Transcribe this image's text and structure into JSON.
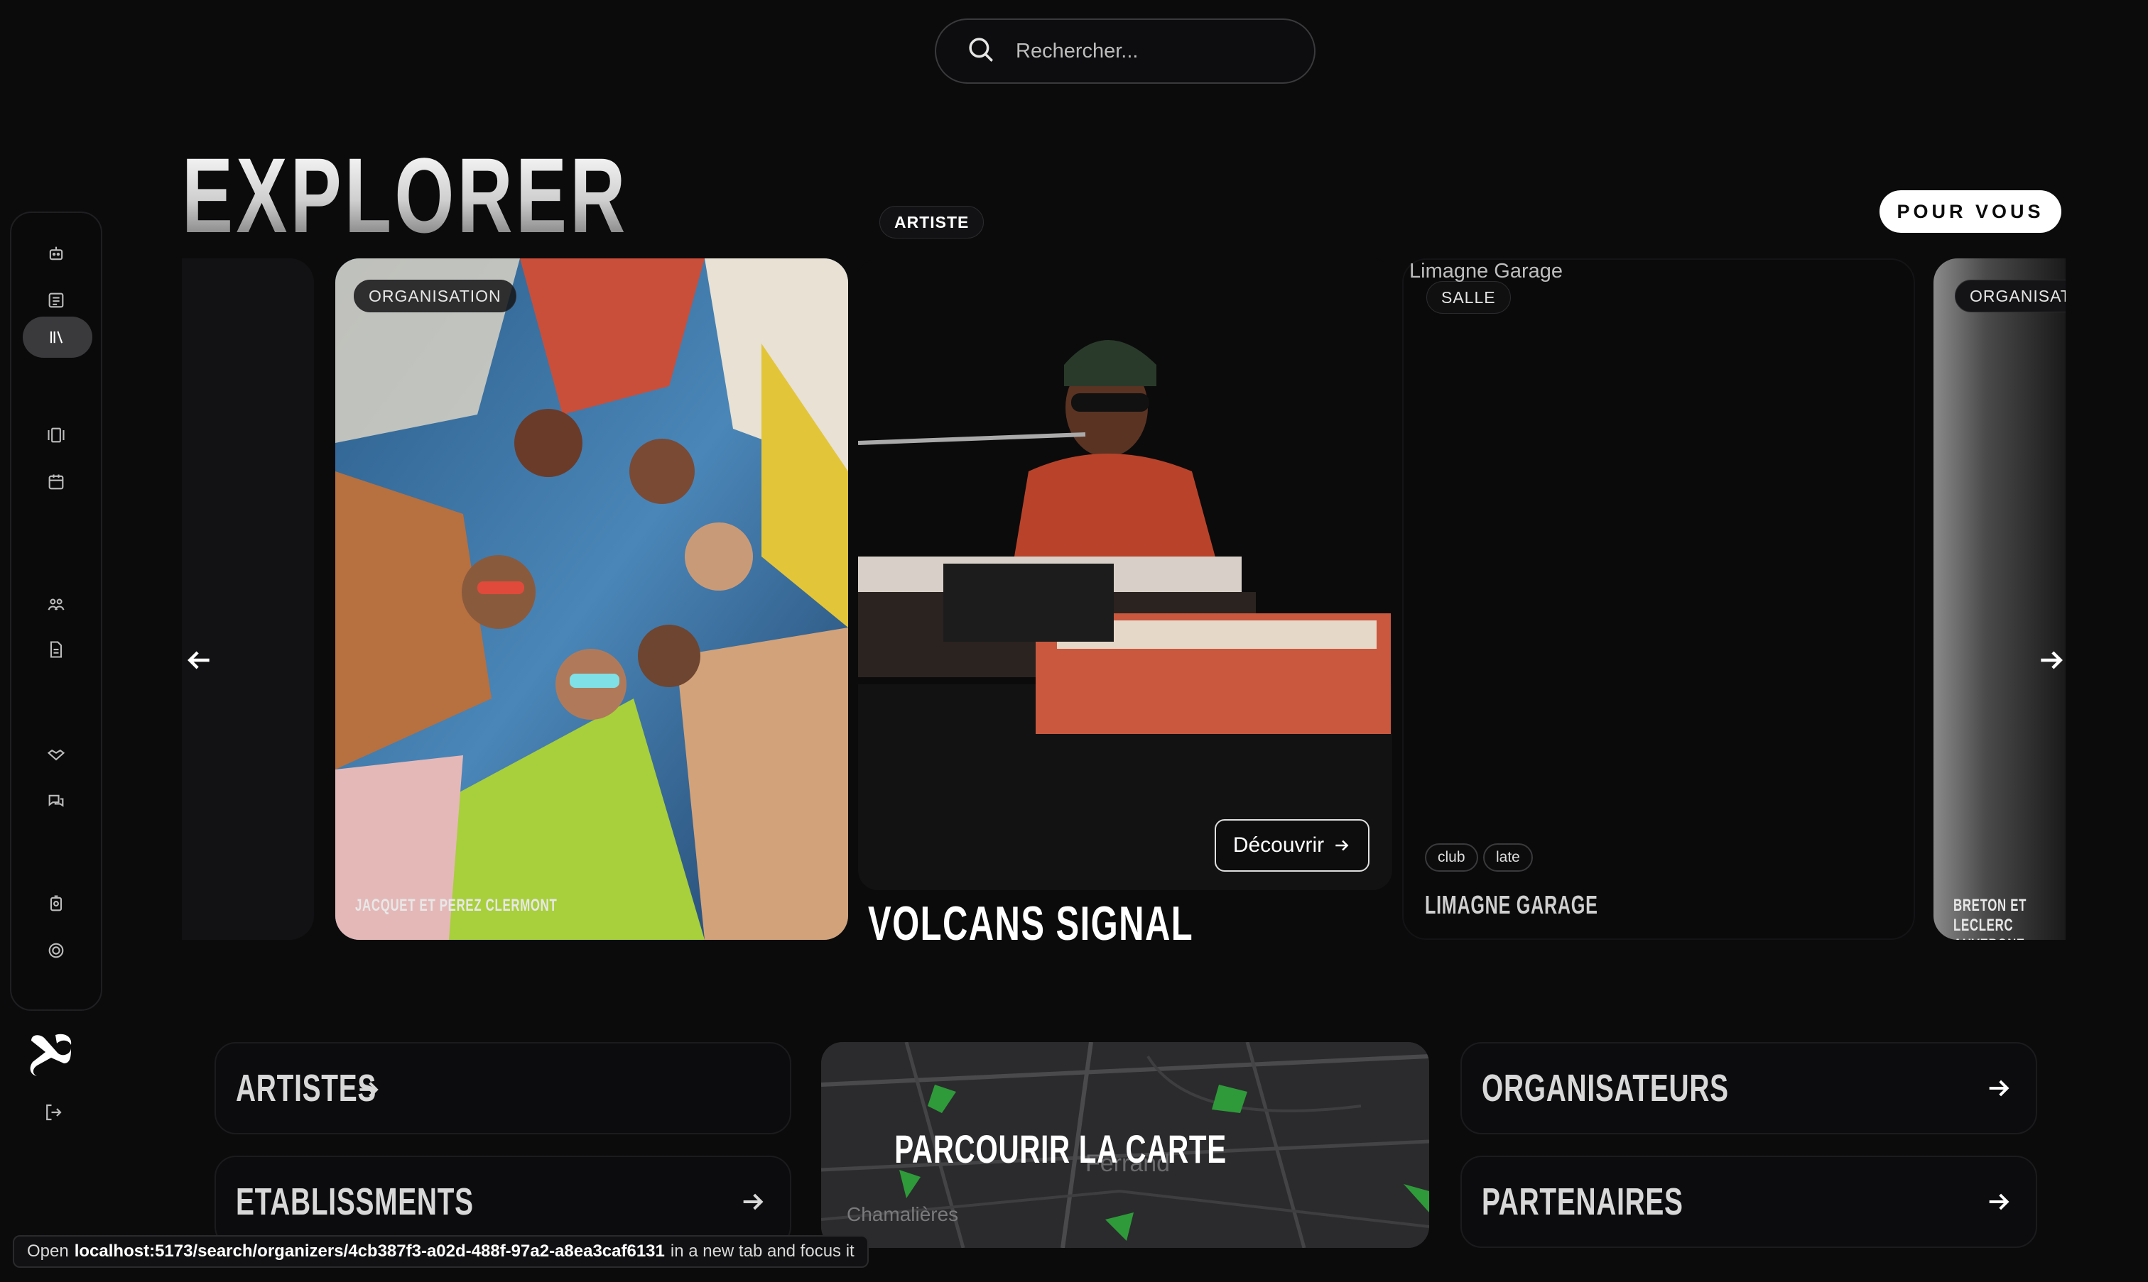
{
  "search": {
    "placeholder": "Rechercher..."
  },
  "sidebar": {
    "items": [
      {
        "icon": "robot-icon"
      },
      {
        "icon": "newspaper-icon"
      },
      {
        "icon": "library-icon",
        "active": true
      },
      {
        "icon": "gallery-icon"
      },
      {
        "icon": "calendar-icon"
      },
      {
        "icon": "crowd-icon"
      },
      {
        "icon": "document-icon"
      },
      {
        "icon": "handshake-icon"
      },
      {
        "icon": "chat-icon"
      },
      {
        "icon": "badge-icon"
      },
      {
        "icon": "coin-icon"
      }
    ],
    "logo": "brand-logo",
    "logout": "logout-icon"
  },
  "page": {
    "title": "EXPLORER",
    "filter_button": "POUR VOUS"
  },
  "carousel": {
    "cards": [
      {
        "type": "ORGANISATION",
        "caption": "JACQUET ET PEREZ CLERMONT"
      },
      {
        "type": "ARTISTE",
        "name": "VOLCANS SIGNAL",
        "cta": "Découvrir"
      },
      {
        "type": "SALLE",
        "image_alt": "Limagne Garage",
        "tags": [
          "club",
          "late"
        ],
        "caption": "LIMAGNE GARAGE"
      },
      {
        "type": "ORGANISATION",
        "caption": "BRETON ET LECLERC AUVERGNE"
      }
    ]
  },
  "tiles": {
    "artistes": "ARTISTES",
    "etablissements": "ETABLISSMENTS",
    "map": "PARCOURIR LA CARTE",
    "map_places": [
      "Chamalières",
      "Ferrand"
    ],
    "organisateurs": "ORGANISATEURS",
    "partenaires": "PARTENAIRES"
  },
  "status": {
    "prefix": "Open",
    "url": "localhost:5173/search/organizers/4cb387f3-a02d-488f-97a2-a8ea3caf6131",
    "suffix": "in a new tab and focus it"
  },
  "colors": {
    "background": "#0b0b0c",
    "accent": "#ffffff",
    "artist_sweater": "#b8432a"
  }
}
